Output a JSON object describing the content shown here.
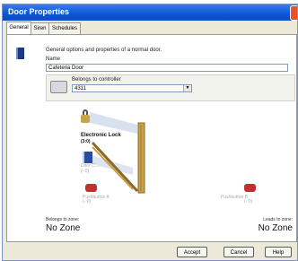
{
  "window": {
    "title": "Door Properties"
  },
  "tabs": [
    {
      "label": "General"
    },
    {
      "label": "Siren"
    },
    {
      "label": "Schedules"
    }
  ],
  "general": {
    "description": "General options and properties of a normal door.",
    "name_label": "Name",
    "name_value": "Cafeteria Door",
    "controller_label": "Belongs to controller",
    "controller_value": "4311"
  },
  "diagram": {
    "lock_label": "Electronic Lock",
    "lock_sub": "(3:0)",
    "contact_label": "Door C...",
    "contact_sub": "(-:0)",
    "pushbutton_a_label": "Pushbutton A",
    "pushbutton_a_sub": "(-:0)",
    "pushbutton_b_label": "Pushbutton B",
    "pushbutton_b_sub": "(-:0)"
  },
  "zones": {
    "belongs_label": "Belongs to zone:",
    "belongs_value": "No Zone",
    "leads_label": "Leads to zone:",
    "leads_value": "No Zone"
  },
  "buttons": {
    "accept": "Accept",
    "cancel": "Cancel",
    "help": "Help"
  },
  "colors": {
    "titlebar": "#0a55d6",
    "door_wood": "#c9a24a",
    "pushbutton": "#c03030"
  }
}
